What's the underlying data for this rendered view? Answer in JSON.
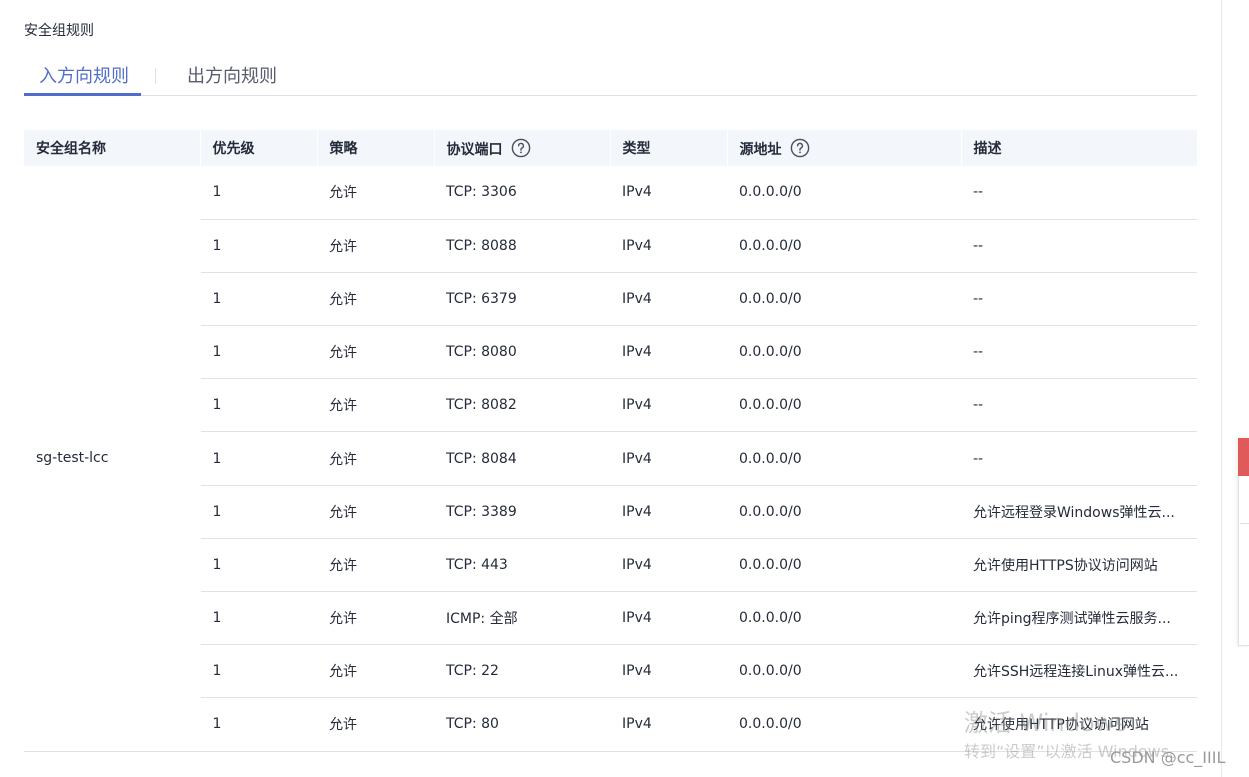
{
  "section_title": "安全组规则",
  "tabs": [
    {
      "label": "入方向规则",
      "active": true
    },
    {
      "label": "出方向规则",
      "active": false
    }
  ],
  "table": {
    "headers": [
      "安全组名称",
      "优先级",
      "策略",
      "协议端口",
      "类型",
      "源地址",
      "描述"
    ],
    "help_icon_columns": [
      "协议端口",
      "源地址"
    ],
    "group_name": "sg-test-lcc",
    "rows": [
      {
        "priority": "1",
        "policy": "允许",
        "port": "TCP: 3306",
        "type": "IPv4",
        "source": "0.0.0.0/0",
        "desc": "--"
      },
      {
        "priority": "1",
        "policy": "允许",
        "port": "TCP: 8088",
        "type": "IPv4",
        "source": "0.0.0.0/0",
        "desc": "--"
      },
      {
        "priority": "1",
        "policy": "允许",
        "port": "TCP: 6379",
        "type": "IPv4",
        "source": "0.0.0.0/0",
        "desc": "--"
      },
      {
        "priority": "1",
        "policy": "允许",
        "port": "TCP: 8080",
        "type": "IPv4",
        "source": "0.0.0.0/0",
        "desc": "--"
      },
      {
        "priority": "1",
        "policy": "允许",
        "port": "TCP: 8082",
        "type": "IPv4",
        "source": "0.0.0.0/0",
        "desc": "--"
      },
      {
        "priority": "1",
        "policy": "允许",
        "port": "TCP: 8084",
        "type": "IPv4",
        "source": "0.0.0.0/0",
        "desc": "--"
      },
      {
        "priority": "1",
        "policy": "允许",
        "port": "TCP: 3389",
        "type": "IPv4",
        "source": "0.0.0.0/0",
        "desc": "允许远程登录Windows弹性云..."
      },
      {
        "priority": "1",
        "policy": "允许",
        "port": "TCP: 443",
        "type": "IPv4",
        "source": "0.0.0.0/0",
        "desc": "允许使用HTTPS协议访问网站"
      },
      {
        "priority": "1",
        "policy": "允许",
        "port": "ICMP: 全部",
        "type": "IPv4",
        "source": "0.0.0.0/0",
        "desc": "允许ping程序测试弹性云服务..."
      },
      {
        "priority": "1",
        "policy": "允许",
        "port": "TCP: 22",
        "type": "IPv4",
        "source": "0.0.0.0/0",
        "desc": "允许SSH远程连接Linux弹性云..."
      },
      {
        "priority": "1",
        "policy": "允许",
        "port": "TCP: 80",
        "type": "IPv4",
        "source": "0.0.0.0/0",
        "desc": "允许使用HTTP协议访问网站"
      }
    ]
  },
  "watermark": {
    "activate_title": "激活 Windows",
    "activate_sub": "转到“设置”以激活 Windows。",
    "csdn": "CSDN @cc_IIIL"
  },
  "colors": {
    "accent": "#526ecc",
    "header_bg": "#f3f6fb",
    "border": "#dfe1e6",
    "text": "#252b3a",
    "side_panel_red": "#e05a5a"
  }
}
